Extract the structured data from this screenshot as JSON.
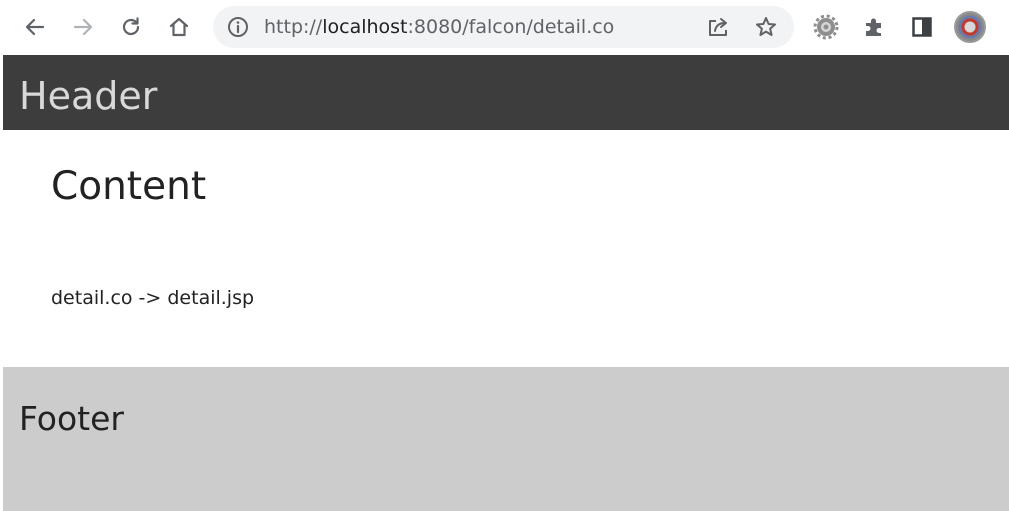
{
  "browser": {
    "url_prefix": "http://",
    "url_host": "localhost",
    "url_rest": ":8080/falcon/detail.co",
    "icons": {
      "back": "back-arrow-icon",
      "forward": "forward-arrow-icon",
      "reload": "reload-icon",
      "home": "home-icon",
      "site_info": "info-icon",
      "share": "share-icon",
      "bookmark": "star-icon",
      "settings_extension": "gear-icon",
      "extensions": "puzzle-icon",
      "side_panel": "side-panel-icon",
      "profile": "avatar"
    }
  },
  "page": {
    "header": {
      "title": "Header"
    },
    "content": {
      "title": "Content",
      "text": "detail.co -> detail.jsp"
    },
    "footer": {
      "title": "Footer"
    }
  },
  "colors": {
    "header_bg": "#3d3d3d",
    "header_text": "#d9d9d9",
    "footer_bg": "#cccccc",
    "content_bg": "#ffffff",
    "text": "#222222"
  }
}
